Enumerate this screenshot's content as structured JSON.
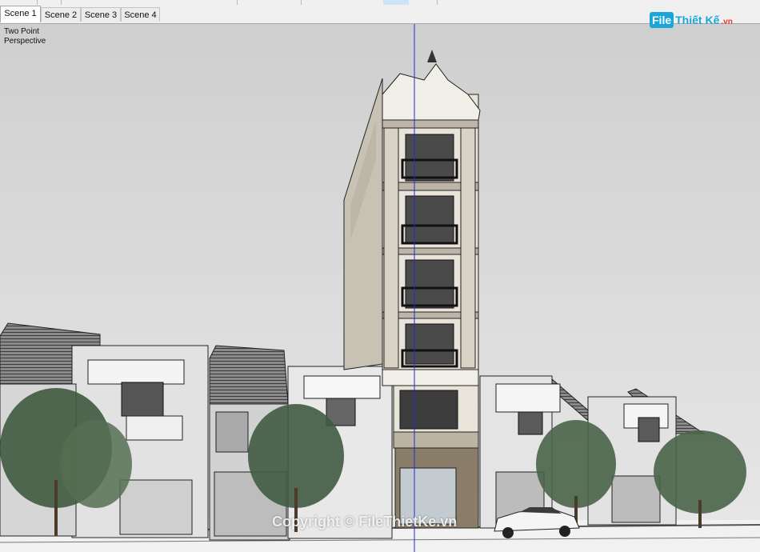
{
  "scene_tabs": [
    {
      "label": "Scene 1",
      "active": true
    },
    {
      "label": "Scene 2",
      "active": false
    },
    {
      "label": "Scene 3",
      "active": false
    },
    {
      "label": "Scene 4",
      "active": false
    }
  ],
  "camera": {
    "line1": "Two Point",
    "line2": "Perspective"
  },
  "logo": {
    "badge": "File",
    "text": "Thiết Kế",
    "domain": ".vn"
  },
  "watermark": "Copyright © FileThietKe.vn",
  "axis_color": "#1f2bd6",
  "sky_color": "#d8d8d8",
  "ground_color": "#f1f1f1"
}
